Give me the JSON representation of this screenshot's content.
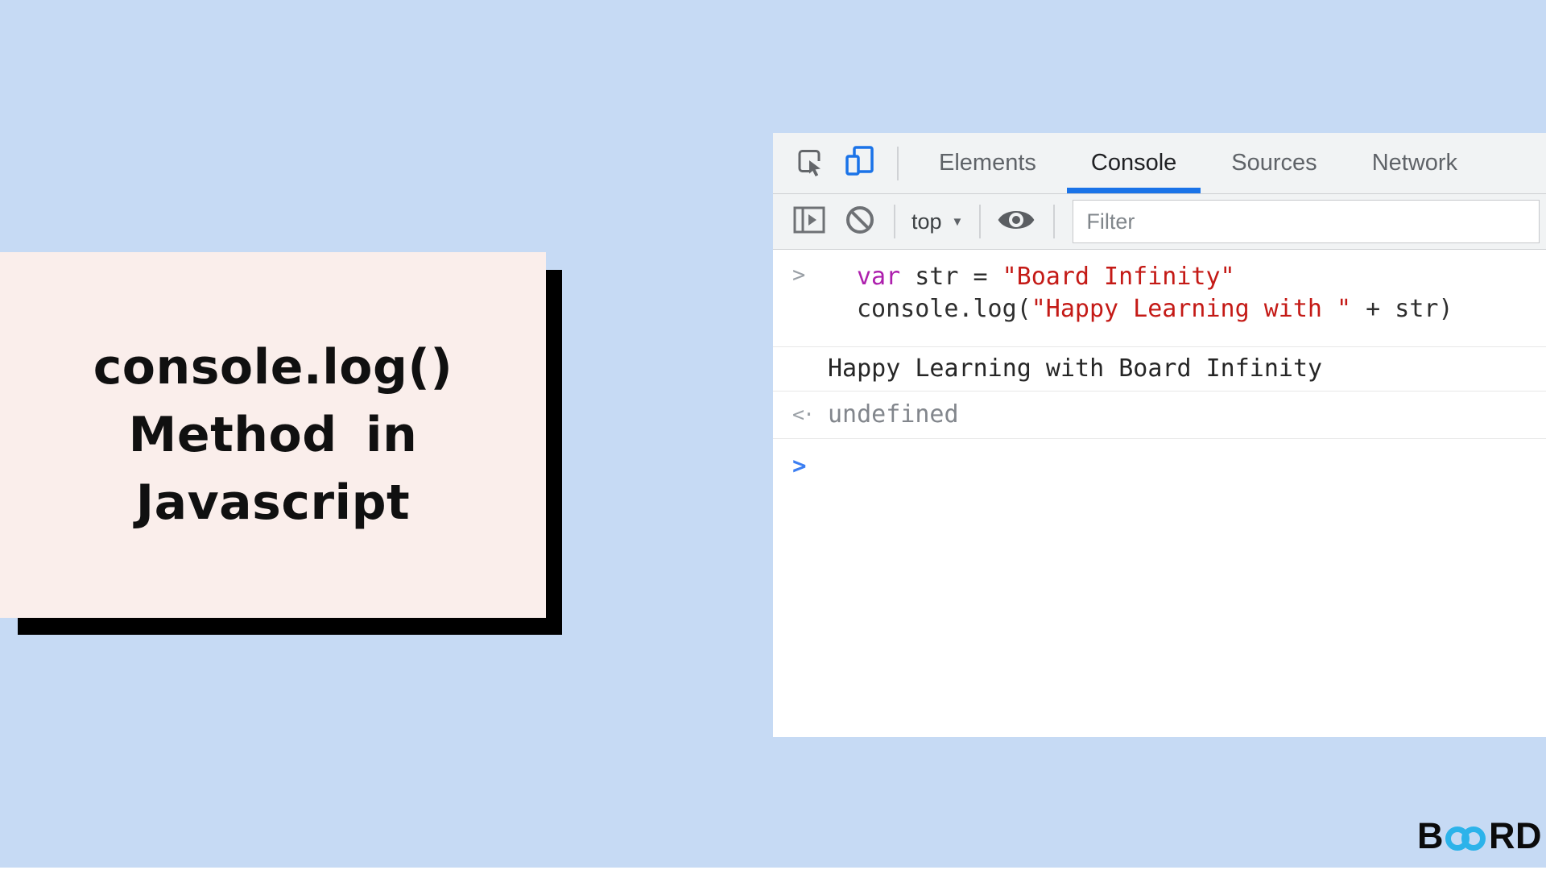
{
  "canvas": {
    "background_color": "#c6daf4"
  },
  "title_card": {
    "line1": "console.log()",
    "line2": "Method in",
    "line3": "Javascript",
    "bg_color": "#faeeeb",
    "shadow_color": "#000000",
    "text_color": "#101010"
  },
  "devtools": {
    "tabs": {
      "elements": "Elements",
      "console": "Console",
      "sources": "Sources",
      "network": "Network"
    },
    "active_tab": "Console",
    "accent_color": "#1a73e8",
    "toolbar": {
      "context_selector": "top",
      "filter_placeholder": "Filter"
    },
    "icons": {
      "inspect": "inspect-cursor-icon",
      "device_toolbar": "device-toolbar-icon",
      "console_sidebar": "console-sidebar-icon",
      "clear_console": "no-entry-circle-icon",
      "live_expression": "eye-icon",
      "dropdown_arrow": "▼"
    },
    "console": {
      "input": {
        "prompt": ">",
        "line1": {
          "keyword": "var",
          "plain": " str = ",
          "string": "\"Board Infinity\""
        },
        "line2": {
          "plain_open": "console.log(",
          "string": "\"Happy Learning with \"",
          "plain_close": " + str)"
        }
      },
      "log_output": "Happy Learning with Board Infinity",
      "return_icon": "<·",
      "return_value": "undefined",
      "bottom_prompt": ">"
    },
    "syntax_colors": {
      "keyword": "#ad1fad",
      "string": "#c41a16",
      "plain": "#2e2e2e"
    }
  },
  "logo": {
    "prefix": "B",
    "suffix": "RD",
    "infinity_color": "#2cb3ea",
    "text_color": "#0b0b0b"
  }
}
